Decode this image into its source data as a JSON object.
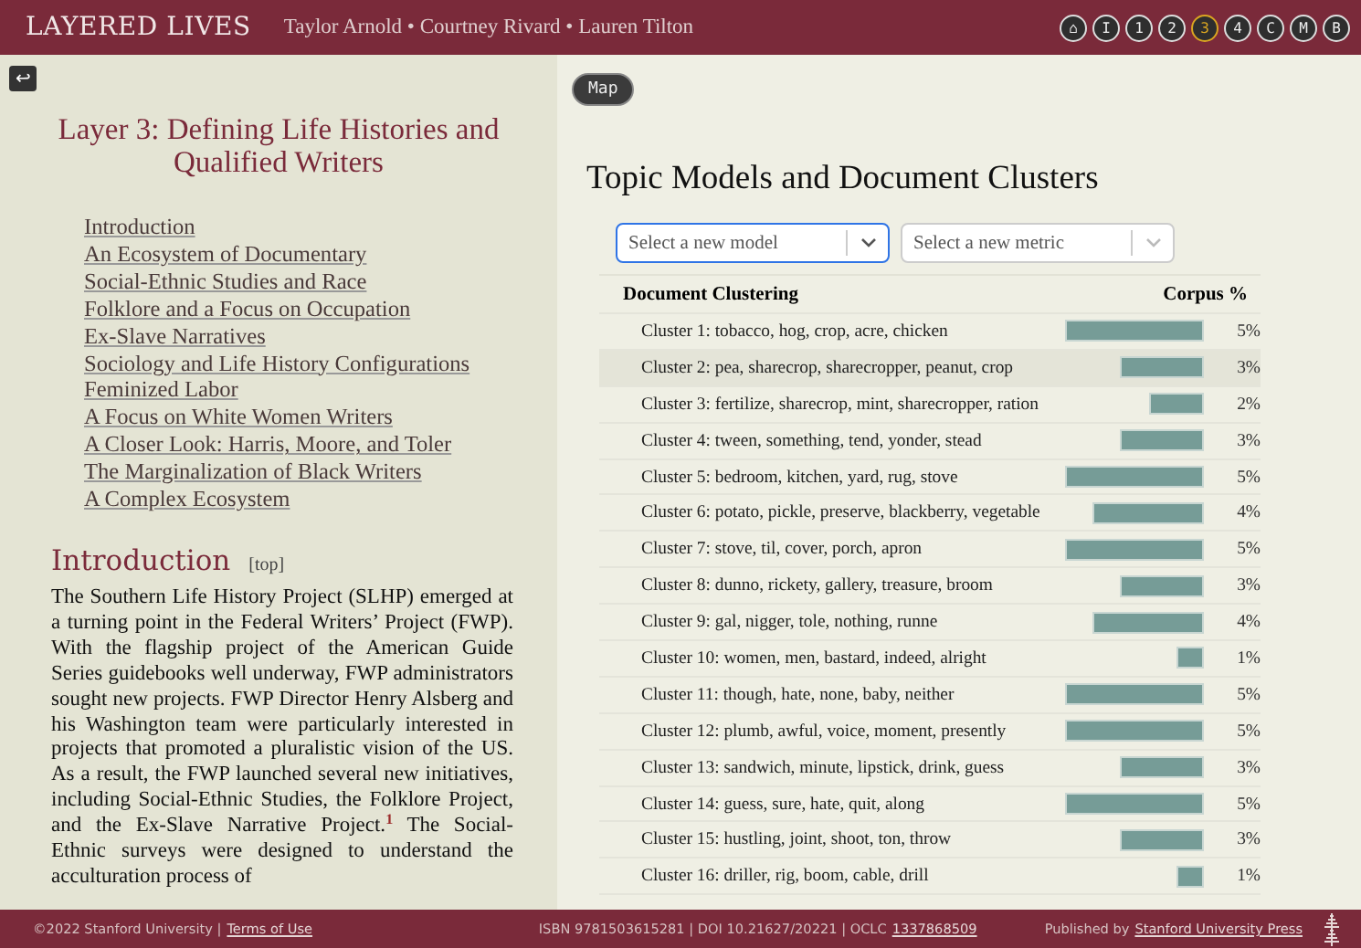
{
  "header": {
    "title": "LAYERED LIVES",
    "authors": "Taylor Arnold • Courtney Rivard • Lauren Tilton",
    "nav": [
      {
        "label": "⌂",
        "selected": false
      },
      {
        "label": "I",
        "selected": false
      },
      {
        "label": "1",
        "selected": false
      },
      {
        "label": "2",
        "selected": false
      },
      {
        "label": "3",
        "selected": true
      },
      {
        "label": "4",
        "selected": false
      },
      {
        "label": "C",
        "selected": false
      },
      {
        "label": "M",
        "selected": false
      },
      {
        "label": "B",
        "selected": false
      }
    ]
  },
  "left": {
    "back_button": "↩",
    "title": "Layer 3: Defining Life Histories and Qualified Writers",
    "toc": [
      "Introduction",
      "An Ecosystem of Documentary",
      "Social-Ethnic Studies and Race",
      "Folklore and a Focus on Occupation",
      "Ex-Slave Narratives",
      "Sociology and Life History Configurations",
      "Feminized Labor",
      "A Focus on White Women Writers",
      "A Closer Look: Harris, Moore, and Toler",
      "The Marginalization of Black Writers",
      "A Complex Ecosystem"
    ],
    "section": {
      "heading": "Introduction",
      "top_link": "[top]",
      "paragraph": "The Southern Life History Project (SLHP) emerged at a turning point in the Federal Writers’ Project (FWP). With the flagship project of the American Guide Series guidebooks well underway, FWP administrators sought new projects. FWP Director Henry Alsberg and his Washington team were particularly interested in projects that promoted a pluralistic vision of the US. As a result, the FWP launched several new initiatives, including Social-Ethnic Studies, the Folklore Project, and the Ex-Slave Narrative Project.$^{1}$ The Social-Ethnic surveys were designed to understand the acculturation process of"
    }
  },
  "right": {
    "map_button": "Map",
    "title": "Topic Models and Document Clusters",
    "selects": [
      {
        "placeholder": "Select a new model",
        "focused": true
      },
      {
        "placeholder": "Select a new metric",
        "focused": false
      }
    ],
    "table": {
      "columns": [
        "Document Clustering",
        "Corpus %"
      ],
      "rows": [
        {
          "label": "Cluster 1: tobacco, hog, crop, acre, chicken",
          "percent": "5%",
          "selected": false
        },
        {
          "label": "Cluster 2: pea, sharecrop, sharecropper, peanut, crop",
          "percent": "3%",
          "selected": true
        },
        {
          "label": "Cluster 3: fertilize, sharecrop, mint, sharecropper, ration",
          "percent": "2%",
          "selected": false
        },
        {
          "label": "Cluster 4: tween, something, tend, yonder, stead",
          "percent": "3%",
          "selected": false
        },
        {
          "label": "Cluster 5: bedroom, kitchen, yard, rug, stove",
          "percent": "5%",
          "selected": false
        },
        {
          "label": "Cluster 6: potato, pickle, preserve, blackberry, vegetable",
          "percent": "4%",
          "selected": false
        },
        {
          "label": "Cluster 7: stove, til, cover, porch, apron",
          "percent": "5%",
          "selected": false
        },
        {
          "label": "Cluster 8: dunno, rickety, gallery, treasure, broom",
          "percent": "3%",
          "selected": false
        },
        {
          "label": "Cluster 9: gal, nigger, tole, nothing, runne",
          "percent": "4%",
          "selected": false
        },
        {
          "label": "Cluster 10: women, men, bastard, indeed, alright",
          "percent": "1%",
          "selected": false
        },
        {
          "label": "Cluster 11: though, hate, none, baby, neither",
          "percent": "5%",
          "selected": false
        },
        {
          "label": "Cluster 12: plumb, awful, voice, moment, presently",
          "percent": "5%",
          "selected": false
        },
        {
          "label": "Cluster 13: sandwich, minute, lipstick, drink, guess",
          "percent": "3%",
          "selected": false
        },
        {
          "label": "Cluster 14: guess, sure, hate, quit, along",
          "percent": "5%",
          "selected": false
        },
        {
          "label": "Cluster 15: hustling, joint, shoot, ton, throw",
          "percent": "3%",
          "selected": false
        },
        {
          "label": "Cluster 16: driller, rig, boom, cable, drill",
          "percent": "1%",
          "selected": false
        }
      ]
    }
  },
  "footer": {
    "copyright": "©2022 Stanford University |",
    "terms_link": "Terms of Use",
    "ids": "ISBN 9781503615281 | DOI 10.21627/20221 | OCLC",
    "oclc_link": "1337868509",
    "published_by": "Published by",
    "press_link": "Stanford University Press"
  }
}
